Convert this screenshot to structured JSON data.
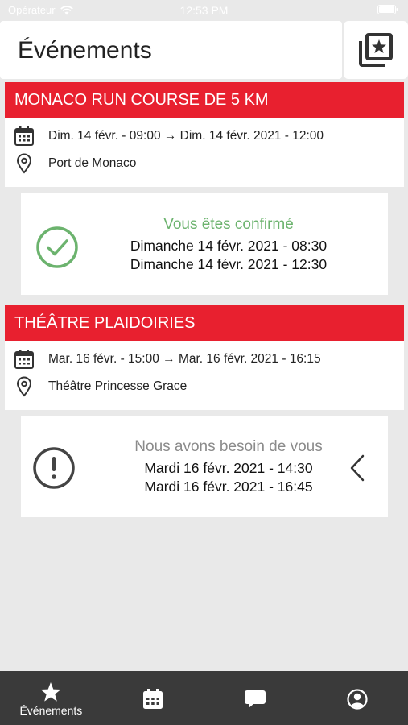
{
  "status_bar": {
    "carrier": "Opérateur",
    "time": "12:53 PM"
  },
  "header": {
    "title": "Événements"
  },
  "colors": {
    "accent": "#e8202f",
    "confirmed": "#6cb36e",
    "pending": "#8b8b8b",
    "tabbar": "#3a3a3a"
  },
  "events": [
    {
      "title": "MONACO RUN COURSE DE 5 KM",
      "dates": "Dim. 14 févr. - 09:00 → Dim. 14 févr. 2021 - 12:00",
      "location": "Port de Monaco",
      "status": {
        "text": "Vous êtes confirmé",
        "start": "Dimanche 14 févr. 2021 - 08:30",
        "end": "Dimanche 14 févr. 2021 - 12:30",
        "icon": "check-circle-icon"
      }
    },
    {
      "title": "THÉÂTRE PLAIDOIRIES",
      "dates": "Mar. 16 févr. - 15:00 → Mar. 16 févr. 2021 - 16:15",
      "location": "Théâtre Princesse Grace",
      "status": {
        "text": "Nous avons besoin de vous",
        "start": "Mardi 16 févr. 2021 - 14:30",
        "end": "Mardi 16 févr. 2021 - 16:45",
        "icon": "exclamation-circle-icon"
      }
    }
  ],
  "tabbar": {
    "tabs": [
      {
        "label": "Événements",
        "icon": "star-icon",
        "active": true
      },
      {
        "label": "",
        "icon": "calendar-icon"
      },
      {
        "label": "",
        "icon": "chat-bubble-icon"
      },
      {
        "label": "",
        "icon": "profile-icon"
      }
    ]
  }
}
